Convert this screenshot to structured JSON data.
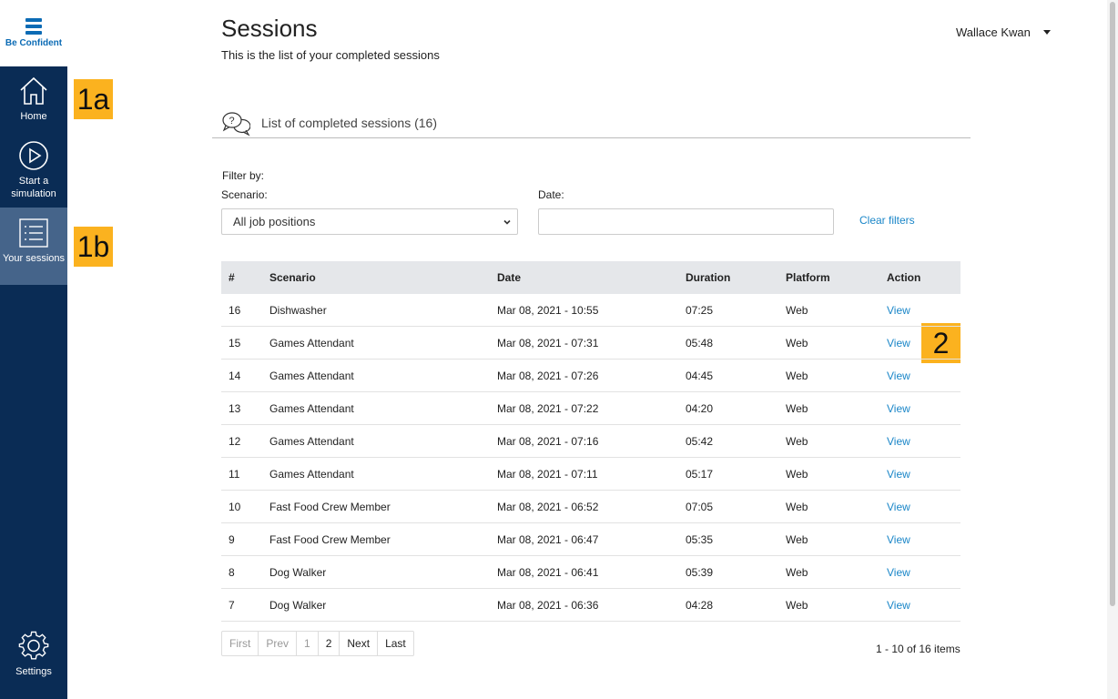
{
  "brand": {
    "name": "Be Confident",
    "color": "#0b6bb5"
  },
  "sidebar": {
    "bg": "#0a2c55",
    "active_bg": "#45648a",
    "items": [
      {
        "label": "Home",
        "icon": "home-icon"
      },
      {
        "label": "Start a simulation",
        "icon": "play-icon"
      },
      {
        "label": "Your sessions",
        "icon": "list-icon",
        "active": true
      },
      {
        "label": "Settings",
        "icon": "gear-icon"
      }
    ]
  },
  "header": {
    "title": "Sessions",
    "subtitle": "This is the list of your completed sessions",
    "user": "Wallace Kwan"
  },
  "section": {
    "title": "List of completed sessions (16)",
    "icon": "chat-bubbles-icon"
  },
  "filters": {
    "heading": "Filter by:",
    "scenario_label": "Scenario:",
    "scenario_value": "All job positions",
    "date_label": "Date:",
    "date_value": "",
    "clear_label": "Clear filters"
  },
  "table": {
    "columns": [
      "#",
      "Scenario",
      "Date",
      "Duration",
      "Platform",
      "Action"
    ],
    "rows": [
      {
        "num": "16",
        "scenario": "Dishwasher",
        "date": "Mar 08, 2021 - 10:55",
        "duration": "07:25",
        "platform": "Web",
        "action": "View"
      },
      {
        "num": "15",
        "scenario": "Games Attendant",
        "date": "Mar 08, 2021 - 07:31",
        "duration": "05:48",
        "platform": "Web",
        "action": "View"
      },
      {
        "num": "14",
        "scenario": "Games Attendant",
        "date": "Mar 08, 2021 - 07:26",
        "duration": "04:45",
        "platform": "Web",
        "action": "View"
      },
      {
        "num": "13",
        "scenario": "Games Attendant",
        "date": "Mar 08, 2021 - 07:22",
        "duration": "04:20",
        "platform": "Web",
        "action": "View"
      },
      {
        "num": "12",
        "scenario": "Games Attendant",
        "date": "Mar 08, 2021 - 07:16",
        "duration": "05:42",
        "platform": "Web",
        "action": "View"
      },
      {
        "num": "11",
        "scenario": "Games Attendant",
        "date": "Mar 08, 2021 - 07:11",
        "duration": "05:17",
        "platform": "Web",
        "action": "View"
      },
      {
        "num": "10",
        "scenario": "Fast Food Crew Member",
        "date": "Mar 08, 2021 - 06:52",
        "duration": "07:05",
        "platform": "Web",
        "action": "View"
      },
      {
        "num": "9",
        "scenario": "Fast Food Crew Member",
        "date": "Mar 08, 2021 - 06:47",
        "duration": "05:35",
        "platform": "Web",
        "action": "View"
      },
      {
        "num": "8",
        "scenario": "Dog Walker",
        "date": "Mar 08, 2021 - 06:41",
        "duration": "05:39",
        "platform": "Web",
        "action": "View"
      },
      {
        "num": "7",
        "scenario": "Dog Walker",
        "date": "Mar 08, 2021 - 06:36",
        "duration": "04:28",
        "platform": "Web",
        "action": "View"
      }
    ]
  },
  "pagination": {
    "first": "First",
    "prev": "Prev",
    "pages": [
      "1",
      "2"
    ],
    "current": "2",
    "next": "Next",
    "last": "Last",
    "summary": "1 - 10 of 16 items"
  },
  "callouts": {
    "home": "1a",
    "sessions": "1b",
    "view": "2",
    "color": "#fbb21f"
  },
  "colors": {
    "link": "#1a86c8",
    "table_header_bg": "#e5e7ea"
  }
}
